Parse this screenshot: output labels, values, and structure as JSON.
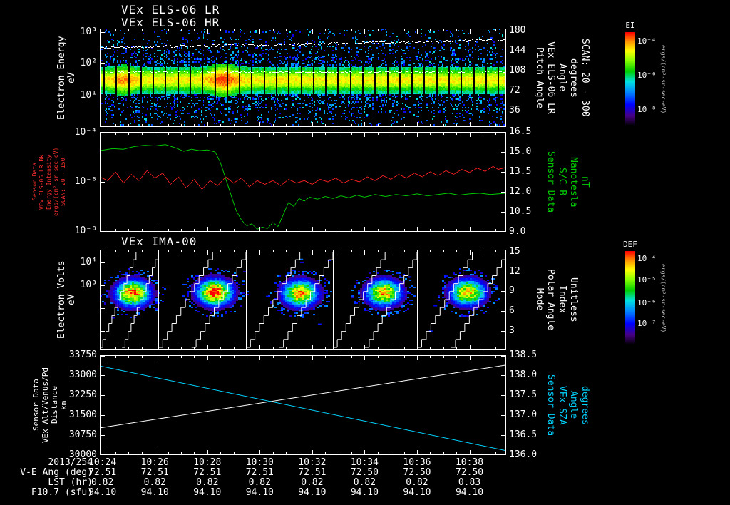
{
  "figure": {
    "bg": "#000000"
  },
  "panels": {
    "els": {
      "titles": [
        "VEx ELS-06 LR",
        "VEx ELS-06 HR"
      ],
      "left_label_lines": [
        "Electron Energy",
        "eV"
      ],
      "right_label_lines": [
        "Pitch Angle",
        "VEx ELS-06 LR",
        "Angle",
        "degrees",
        "SCAN: 20 - 300"
      ],
      "left_ticks": [
        {
          "label": "10³",
          "frac": 0.037
        },
        {
          "label": "10²",
          "frac": 0.358
        },
        {
          "label": "10¹",
          "frac": 0.679
        }
      ],
      "right_ticks": [
        {
          "label": "180",
          "frac": 0.02
        },
        {
          "label": "144",
          "frac": 0.223
        },
        {
          "label": "108",
          "frac": 0.426
        },
        {
          "label": "72",
          "frac": 0.629
        },
        {
          "label": "36",
          "frac": 0.832
        }
      ]
    },
    "bk": {
      "left_label_lines": [
        "Sensor Data",
        "VEx ELS-06 LR Bk",
        "Energy Intensity",
        "ergs/(cm²-sr-sec-eV)",
        "SCAN: 20 - 150"
      ],
      "left_label_color": "#ff3030",
      "right_label_lines": [
        "Sensor Data",
        "S/C B",
        "Nanotesla",
        "nT"
      ],
      "right_label_color": "#00cc00",
      "left_ticks": [
        {
          "label": "10⁻⁴",
          "frac": 0.01
        },
        {
          "label": "10⁻⁶",
          "frac": 0.5
        },
        {
          "label": "10⁻⁸",
          "frac": 0.99
        }
      ],
      "right_ticks": [
        {
          "label": "16.5",
          "frac": 0.0
        },
        {
          "label": "15.0",
          "frac": 0.2
        },
        {
          "label": "13.5",
          "frac": 0.4
        },
        {
          "label": "12.0",
          "frac": 0.6
        },
        {
          "label": "10.5",
          "frac": 0.8
        },
        {
          "label": "9.0",
          "frac": 1.0
        }
      ]
    },
    "ima": {
      "title": "VEx IMA-00",
      "left_label_lines": [
        "Electron Volts",
        "eV"
      ],
      "right_label_lines": [
        "Mode",
        "Polar Angle",
        "Index",
        "Unitless"
      ],
      "left_ticks": [
        {
          "label": "10⁴",
          "frac": 0.129
        },
        {
          "label": "10³",
          "frac": 0.357
        }
      ],
      "extra_left_fracs": [
        0.585,
        0.813
      ],
      "right_ticks": [
        {
          "label": "15",
          "frac": 0.02
        },
        {
          "label": "12",
          "frac": 0.218
        },
        {
          "label": "9",
          "frac": 0.416
        },
        {
          "label": "6",
          "frac": 0.614
        },
        {
          "label": "3",
          "frac": 0.812
        }
      ]
    },
    "alt": {
      "left_label_lines": [
        "Sensor Data",
        "VEx Alt/Venus/Pd",
        "Distance",
        "km"
      ],
      "right_label_lines": [
        "Sensor Data",
        "VEx SZA",
        "Angle",
        "degrees"
      ],
      "right_label_color": "#00d2ff",
      "left_ticks": [
        {
          "label": "33750",
          "frac": 0.0
        },
        {
          "label": "33000",
          "frac": 0.2
        },
        {
          "label": "32250",
          "frac": 0.4
        },
        {
          "label": "31500",
          "frac": 0.6
        },
        {
          "label": "30750",
          "frac": 0.8
        },
        {
          "label": "30000",
          "frac": 1.0
        }
      ],
      "right_ticks": [
        {
          "label": "138.5",
          "frac": 0.0
        },
        {
          "label": "138.0",
          "frac": 0.2
        },
        {
          "label": "137.5",
          "frac": 0.4
        },
        {
          "label": "137.0",
          "frac": 0.6
        },
        {
          "label": "136.5",
          "frac": 0.8
        },
        {
          "label": "136.0",
          "frac": 1.0
        }
      ]
    }
  },
  "colorbars": [
    {
      "label": "EI",
      "units": "ergs/(cm²-sr-sec-eV)",
      "ticks": [
        {
          "label": "10⁻⁴",
          "frac": 0.09
        },
        {
          "label": "10⁻⁶",
          "frac": 0.46
        },
        {
          "label": "10⁻⁸",
          "frac": 0.83
        }
      ]
    },
    {
      "label": "DEF",
      "units": "ergs/(cm²-sr-sec-eV)",
      "ticks": [
        {
          "label": "10⁻⁴",
          "frac": 0.077
        },
        {
          "label": "10⁻⁵",
          "frac": 0.31
        },
        {
          "label": "10⁻⁶",
          "frac": 0.55
        },
        {
          "label": "10⁻⁷",
          "frac": 0.78
        }
      ]
    }
  ],
  "time_axis": {
    "date": "2013/254",
    "tick_labels": [
      "10:24",
      "10:26",
      "10:28",
      "10:30",
      "10:32",
      "10:34",
      "10:36",
      "10:38"
    ],
    "tick_minutes": [
      0,
      2,
      4,
      6,
      8,
      10,
      12,
      14
    ],
    "tmin": -0.1,
    "tmax": 15.4
  },
  "table": {
    "rows": [
      {
        "label": "V-E Ang (deg)",
        "values": [
          "72.51",
          "72.51",
          "72.51",
          "72.51",
          "72.51",
          "72.50",
          "72.50",
          "72.50"
        ]
      },
      {
        "label": "LST (hr)",
        "values": [
          "0.82",
          "0.82",
          "0.82",
          "0.82",
          "0.82",
          "0.82",
          "0.82",
          "0.83"
        ]
      },
      {
        "label": "F10.7 (sfu)",
        "values": [
          "94.10",
          "94.10",
          "94.10",
          "94.10",
          "94.10",
          "94.10",
          "94.10",
          "94.10"
        ]
      }
    ]
  },
  "chart_data": [
    {
      "id": "els",
      "type": "heatmap",
      "title": "VEx ELS-06 LR / VEx ELS-06 HR",
      "x_axis": "UT on 2013/254 from 10:24 to ~10:39",
      "y_axis": "Electron Energy (eV), log scale",
      "y_range": [
        1.0,
        1300
      ],
      "y2_axis": "Pitch Angle (degrees), SCAN: 20 - 300",
      "y2_range": [
        0,
        184
      ],
      "z_units": "ergs/(cm²-sr-sec-eV)",
      "z_range_shown": [
        1e-08,
        0.0001
      ],
      "band_center_ev": 32,
      "band_sigma_decades": 0.22,
      "band_brighten_times_min": [
        0.8,
        4.6
      ],
      "sweep_gap_period_min": 0.47,
      "sc_potential_trace_ev": 55,
      "pitch_trace_deg": [
        [
          -0.1,
          149
        ],
        [
          2,
          151
        ],
        [
          4,
          152
        ],
        [
          5,
          154
        ],
        [
          6,
          153
        ],
        [
          8,
          156
        ],
        [
          10,
          158
        ],
        [
          12,
          160
        ],
        [
          14,
          162
        ],
        [
          15.4,
          163
        ]
      ]
    },
    {
      "id": "bk_b",
      "type": "line",
      "series": [
        {
          "name": "VEx ELS-06 LR Bk Energy Intensity",
          "color": "#ff2222",
          "units": "log10 of ergs/(cm²-sr-sec-eV)",
          "yrange": [
            -8,
            -4
          ],
          "points": [
            [
              -0.1,
              -5.8
            ],
            [
              0.2,
              -5.95
            ],
            [
              0.5,
              -5.6
            ],
            [
              0.8,
              -6.05
            ],
            [
              1.1,
              -5.7
            ],
            [
              1.4,
              -5.95
            ],
            [
              1.7,
              -5.55
            ],
            [
              2.0,
              -5.85
            ],
            [
              2.3,
              -5.65
            ],
            [
              2.6,
              -6.1
            ],
            [
              2.9,
              -5.8
            ],
            [
              3.2,
              -6.25
            ],
            [
              3.5,
              -5.9
            ],
            [
              3.8,
              -6.3
            ],
            [
              4.1,
              -5.95
            ],
            [
              4.4,
              -6.15
            ],
            [
              4.7,
              -5.8
            ],
            [
              5.0,
              -6.05
            ],
            [
              5.3,
              -5.85
            ],
            [
              5.6,
              -6.2
            ],
            [
              5.9,
              -5.95
            ],
            [
              6.2,
              -6.1
            ],
            [
              6.5,
              -5.95
            ],
            [
              6.8,
              -6.15
            ],
            [
              7.1,
              -5.9
            ],
            [
              7.4,
              -6.05
            ],
            [
              7.7,
              -5.95
            ],
            [
              8.0,
              -6.1
            ],
            [
              8.3,
              -5.9
            ],
            [
              8.6,
              -6.0
            ],
            [
              8.9,
              -5.85
            ],
            [
              9.2,
              -6.05
            ],
            [
              9.5,
              -5.9
            ],
            [
              9.8,
              -6.0
            ],
            [
              10.1,
              -5.8
            ],
            [
              10.4,
              -5.95
            ],
            [
              10.7,
              -5.75
            ],
            [
              11.0,
              -5.9
            ],
            [
              11.3,
              -5.7
            ],
            [
              11.6,
              -5.85
            ],
            [
              11.9,
              -5.65
            ],
            [
              12.2,
              -5.8
            ],
            [
              12.5,
              -5.6
            ],
            [
              12.8,
              -5.75
            ],
            [
              13.1,
              -5.55
            ],
            [
              13.4,
              -5.7
            ],
            [
              13.7,
              -5.5
            ],
            [
              14.0,
              -5.62
            ],
            [
              14.3,
              -5.45
            ],
            [
              14.6,
              -5.58
            ],
            [
              14.9,
              -5.38
            ],
            [
              15.1,
              -5.5
            ],
            [
              15.4,
              -5.42
            ]
          ]
        },
        {
          "name": "S/C B",
          "color": "#00cc00",
          "units": "nT",
          "yrange": [
            9.0,
            16.5
          ],
          "points": [
            [
              -0.1,
              15.1
            ],
            [
              0.4,
              15.25
            ],
            [
              0.8,
              15.2
            ],
            [
              1.2,
              15.4
            ],
            [
              1.6,
              15.5
            ],
            [
              2.0,
              15.45
            ],
            [
              2.4,
              15.55
            ],
            [
              2.8,
              15.3
            ],
            [
              3.1,
              15.05
            ],
            [
              3.4,
              15.2
            ],
            [
              3.7,
              15.1
            ],
            [
              4.0,
              15.15
            ],
            [
              4.3,
              15.0
            ],
            [
              4.5,
              14.2
            ],
            [
              4.7,
              13.0
            ],
            [
              4.9,
              11.8
            ],
            [
              5.1,
              10.6
            ],
            [
              5.3,
              9.9
            ],
            [
              5.5,
              9.45
            ],
            [
              5.7,
              9.6
            ],
            [
              5.9,
              9.2
            ],
            [
              6.1,
              9.35
            ],
            [
              6.3,
              9.25
            ],
            [
              6.5,
              9.7
            ],
            [
              6.7,
              9.4
            ],
            [
              6.9,
              10.3
            ],
            [
              7.1,
              11.2
            ],
            [
              7.3,
              10.9
            ],
            [
              7.5,
              11.5
            ],
            [
              7.7,
              11.3
            ],
            [
              7.9,
              11.6
            ],
            [
              8.2,
              11.45
            ],
            [
              8.5,
              11.65
            ],
            [
              8.8,
              11.5
            ],
            [
              9.1,
              11.7
            ],
            [
              9.4,
              11.55
            ],
            [
              9.7,
              11.75
            ],
            [
              10.0,
              11.6
            ],
            [
              10.4,
              11.8
            ],
            [
              10.8,
              11.65
            ],
            [
              11.2,
              11.8
            ],
            [
              11.6,
              11.7
            ],
            [
              12.0,
              11.85
            ],
            [
              12.4,
              11.7
            ],
            [
              12.8,
              11.8
            ],
            [
              13.2,
              11.9
            ],
            [
              13.6,
              11.75
            ],
            [
              14.0,
              11.85
            ],
            [
              14.4,
              11.9
            ],
            [
              14.8,
              11.8
            ],
            [
              15.4,
              11.9
            ]
          ]
        }
      ]
    },
    {
      "id": "ima",
      "type": "heatmap",
      "title": "VEx IMA-00",
      "y_axis": "Electron Volts (eV), log scale",
      "y_range": [
        1.5,
        37000
      ],
      "y2_axis": "Mode / Polar Angle Index (Unitless)",
      "y2_range": [
        0,
        15.3
      ],
      "z_units": "DEF, ergs/(cm²-sr-sec-eV)",
      "z_range_shown": [
        1e-07,
        0.0001
      ],
      "blobs": [
        {
          "t": 1.12,
          "ev": 480,
          "peak": 0.93
        },
        {
          "t": 4.25,
          "ev": 520,
          "peak": 1.0
        },
        {
          "t": 7.51,
          "ev": 470,
          "peak": 0.9
        },
        {
          "t": 10.7,
          "ev": 500,
          "peak": 0.88
        },
        {
          "t": 13.9,
          "ev": 520,
          "peak": 0.86
        }
      ],
      "segment_boundaries_min": [
        2.13,
        5.47,
        8.79,
        12.0
      ],
      "staircase_steps": 12
    },
    {
      "id": "alt_sza",
      "type": "line",
      "series": [
        {
          "name": "VEx Alt/Venus/Pd Distance",
          "color": "#ffffff",
          "units": "km",
          "yrange": [
            30000,
            33750
          ],
          "points": [
            [
              -0.1,
              31020
            ],
            [
              15.4,
              33380
            ]
          ]
        },
        {
          "name": "VEx SZA Angle",
          "color": "#00d2ff",
          "units": "degrees",
          "yrange": [
            136.0,
            138.5
          ],
          "points": [
            [
              -0.1,
              138.23
            ],
            [
              7.6,
              137.18
            ],
            [
              15.4,
              136.11
            ]
          ]
        }
      ]
    }
  ]
}
